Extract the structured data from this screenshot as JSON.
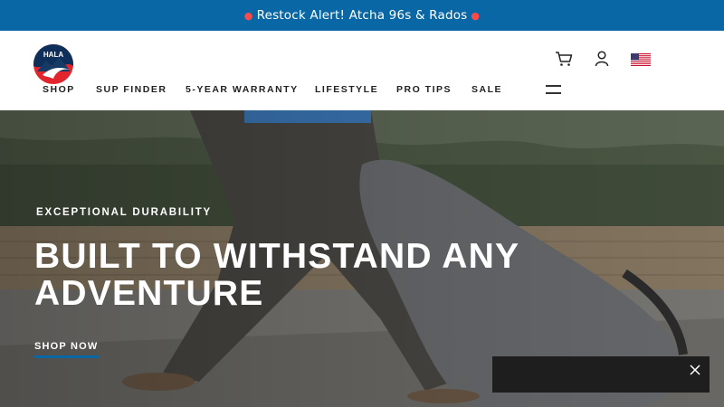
{
  "announcement": {
    "text": "Restock Alert! Atcha 96s & Rados",
    "icon": "siren-emoji"
  },
  "header": {
    "logo_text": "HALA",
    "nav": [
      {
        "label": "SHOP"
      },
      {
        "label": "SUP FINDER"
      },
      {
        "label": "5-YEAR WARRANTY"
      },
      {
        "label": "LIFESTYLE"
      },
      {
        "label": "PRO TIPS"
      },
      {
        "label": "SALE"
      }
    ],
    "icons": [
      "cart-icon",
      "account-icon",
      "us-flag-icon",
      "menu-icon"
    ]
  },
  "hero": {
    "eyebrow": "EXCEPTIONAL DURABILITY",
    "headline": "BUILT TO WITHSTAND ANY ADVENTURE",
    "cta": "SHOP NOW"
  },
  "colors": {
    "brand_blue": "#0a67a5",
    "logo_red": "#e2242c",
    "popup_bg": "#1e1e1e"
  }
}
